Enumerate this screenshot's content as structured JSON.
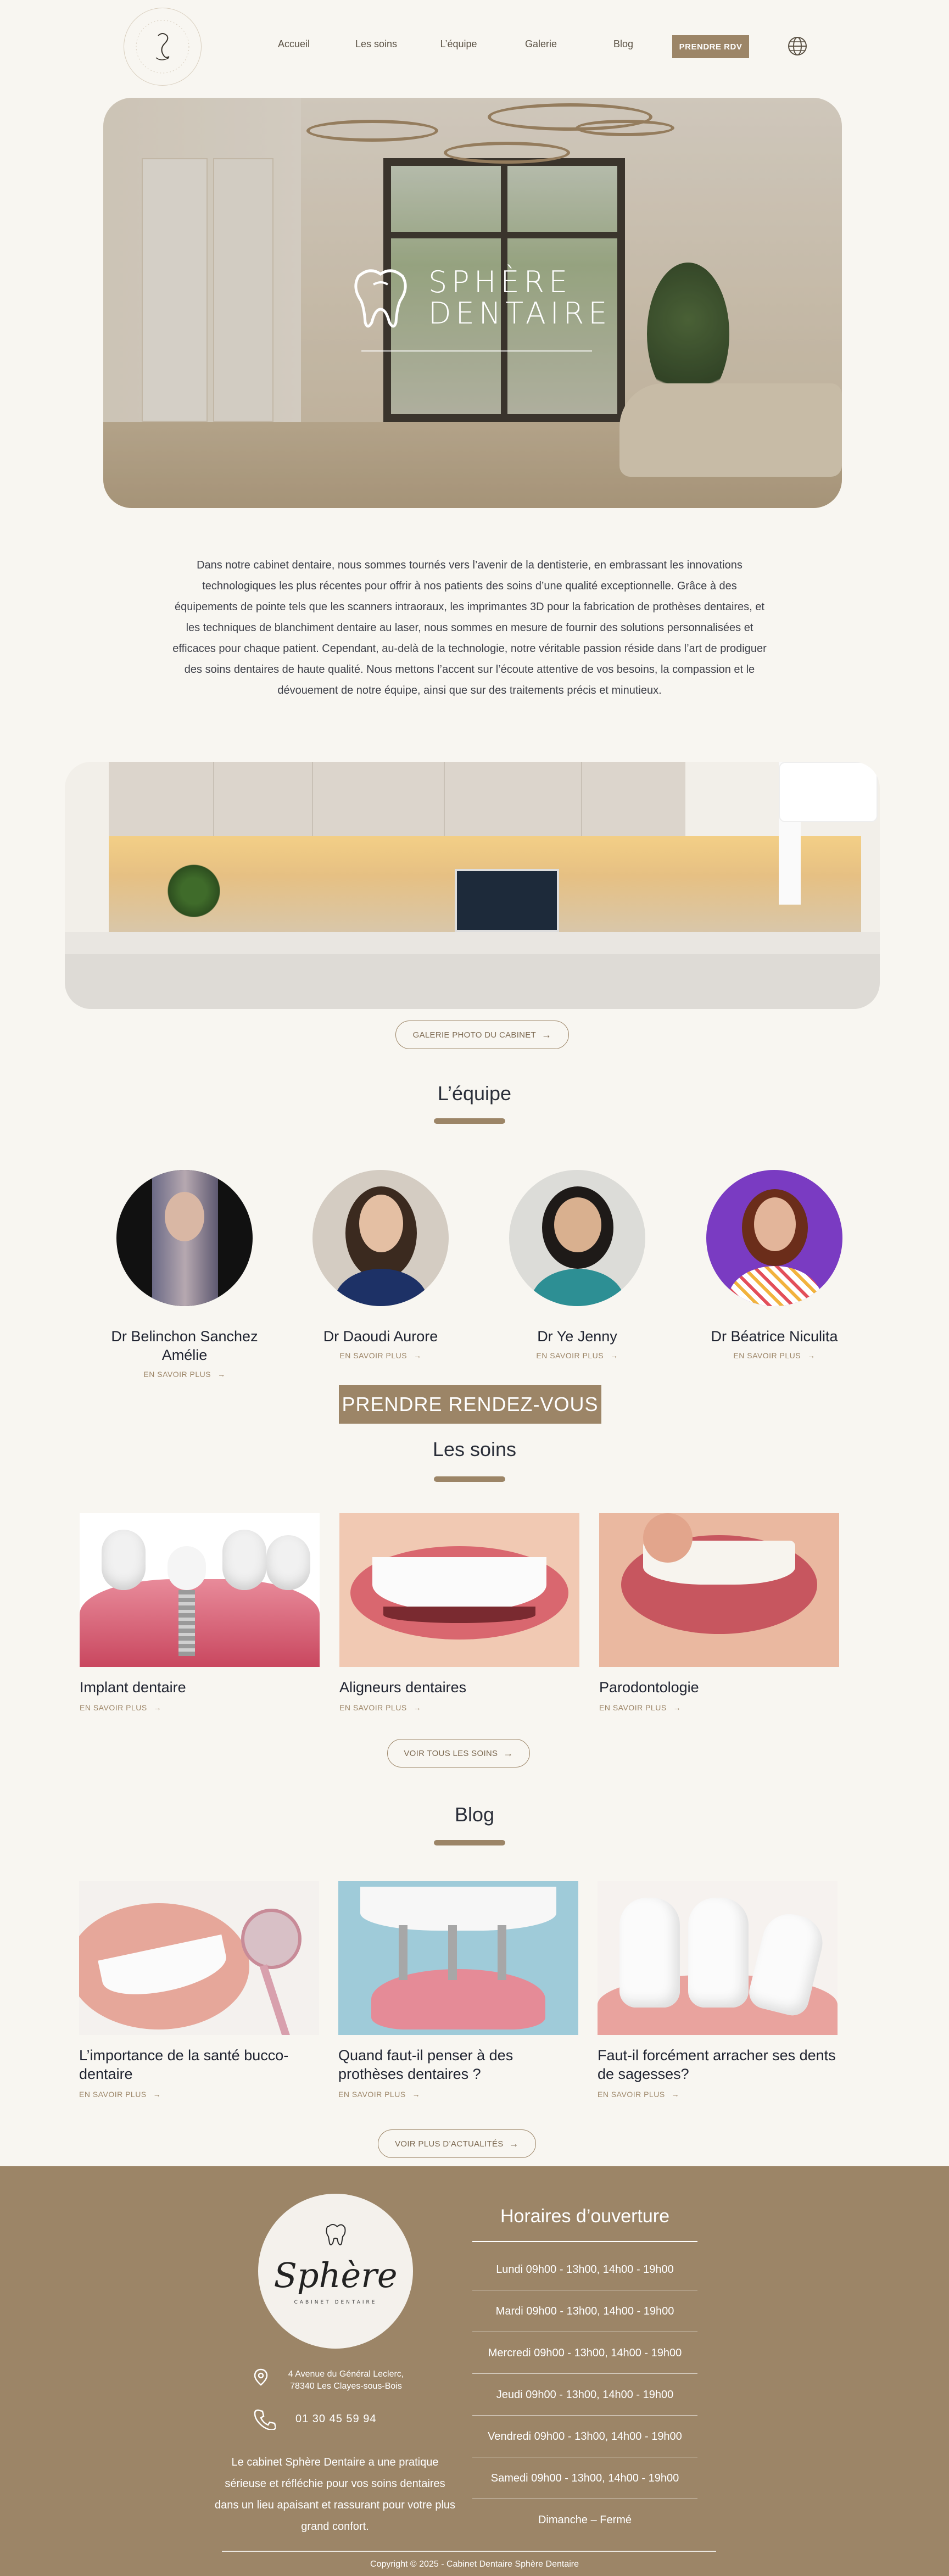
{
  "header": {
    "nav": [
      "Accueil",
      "Les soins",
      "L’équipe",
      "Galerie",
      "Blog"
    ],
    "cta": "PRENDRE RDV"
  },
  "hero": {
    "brand_line1": "SPHÈRE",
    "brand_line2": "DENTAIRE"
  },
  "intro": "Dans notre cabinet dentaire, nous sommes tournés vers l’avenir de la dentisterie, en embrassant les innovations technologiques les plus récentes pour offrir à nos patients des soins d’une qualité exceptionnelle. Grâce à des équipements de pointe tels que les scanners intraoraux, les imprimantes 3D pour la fabrication de prothèses dentaires, et les techniques de blanchiment dentaire au laser, nous sommes en mesure de fournir des solutions personnalisées et efficaces pour chaque patient. Cependant, au-delà de la technologie, notre véritable passion réside dans l’art de prodiguer des soins dentaires de haute qualité. Nous mettons l’accent sur l’écoute attentive de vos besoins, la compassion et le dévouement de notre équipe, ainsi que sur des traitements précis et minutieux.",
  "gallery_button": "GALERIE PHOTO DU CABINET",
  "team": {
    "title": "L’équipe",
    "members": [
      {
        "name": "Dr Belinchon Sanchez Amélie",
        "more": "EN SAVOIR PLUS"
      },
      {
        "name": "Dr Daoudi Aurore",
        "more": "EN SAVOIR PLUS"
      },
      {
        "name": "Dr Ye Jenny",
        "more": "EN SAVOIR PLUS"
      },
      {
        "name": "Dr Béatrice Niculita",
        "more": "EN SAVOIR PLUS"
      }
    ]
  },
  "rdv_big": "PRENDRE RENDEZ-VOUS",
  "soins": {
    "title": "Les soins",
    "items": [
      {
        "title": "Implant dentaire",
        "more": "EN SAVOIR PLUS"
      },
      {
        "title": "Aligneurs dentaires",
        "more": "EN SAVOIR PLUS"
      },
      {
        "title": "Parodontologie",
        "more": "EN SAVOIR PLUS"
      }
    ],
    "all_button": "VOIR TOUS LES SOINS"
  },
  "blog": {
    "title": "Blog",
    "items": [
      {
        "title": "L’importance de la santé bucco-dentaire",
        "more": "EN SAVOIR PLUS"
      },
      {
        "title": "Quand faut-il penser à des prothèses dentaires ?",
        "more": "EN SAVOIR PLUS"
      },
      {
        "title": "Faut-il forcément arracher ses dents de sagesses?",
        "more": "EN SAVOIR PLUS"
      }
    ],
    "all_button": "VOIR PLUS D’ACTUALITÉS"
  },
  "footer": {
    "logo_text": "Sphère",
    "logo_sub": "CABINET DENTAIRE",
    "address": "4 Avenue du Général Leclerc, 78340 Les Clayes-sous-Bois",
    "phone": "01 30 45 59 94",
    "about": "Le cabinet Sphère Dentaire a une pratique sérieuse et réfléchie pour vos soins dentaires dans un lieu apaisant et rassurant pour votre plus grand confort.",
    "hours_title": "Horaires d’ouverture",
    "hours": [
      "Lundi 09h00 - 13h00, 14h00 - 19h00",
      "Mardi  09h00 - 13h00, 14h00 - 19h00",
      "Mercredi  09h00 - 13h00, 14h00 - 19h00",
      "Jeudi  09h00 - 13h00, 14h00 - 19h00",
      "Vendredi  09h00 - 13h00, 14h00 - 19h00",
      "Samedi  09h00 - 13h00, 14h00 - 19h00",
      "Dimanche –  Fermé"
    ],
    "copyright": "Copyright © 2025 - Cabinet Dentaire Sphère Dentaire"
  },
  "colors": {
    "accent": "#9c8567",
    "background": "#f8f6f1",
    "text": "#2b2f3a"
  }
}
